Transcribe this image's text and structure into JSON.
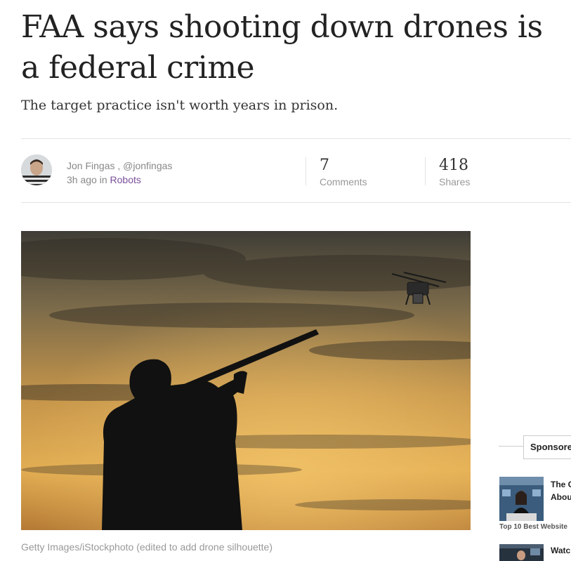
{
  "article": {
    "headline": "FAA says shooting down drones is a federal crime",
    "subhead": "The target practice isn't worth years in prison.",
    "author": {
      "name": "Jon Fingas",
      "separator": " , ",
      "handle": "@jonfingas",
      "time": "3h ago",
      "in_word": "in",
      "category": "Robots"
    },
    "stats": {
      "comments": {
        "count": "7",
        "label": "Comments"
      },
      "shares": {
        "count": "418",
        "label": "Shares"
      }
    },
    "image_caption": "Getty Images/iStockphoto (edited to add drone silhouette)"
  },
  "sidebar": {
    "sponsored_label": "Sponsore",
    "promos": [
      {
        "title_line1": "The C",
        "title_line2": "Abou",
        "footer": "Top 10 Best Website"
      },
      {
        "title_line1": "Watc"
      }
    ]
  },
  "colors": {
    "category_link": "#7a4f9a",
    "sky_top": "#4a463c",
    "sky_glow": "#e0a948",
    "silhouette": "#111111"
  }
}
